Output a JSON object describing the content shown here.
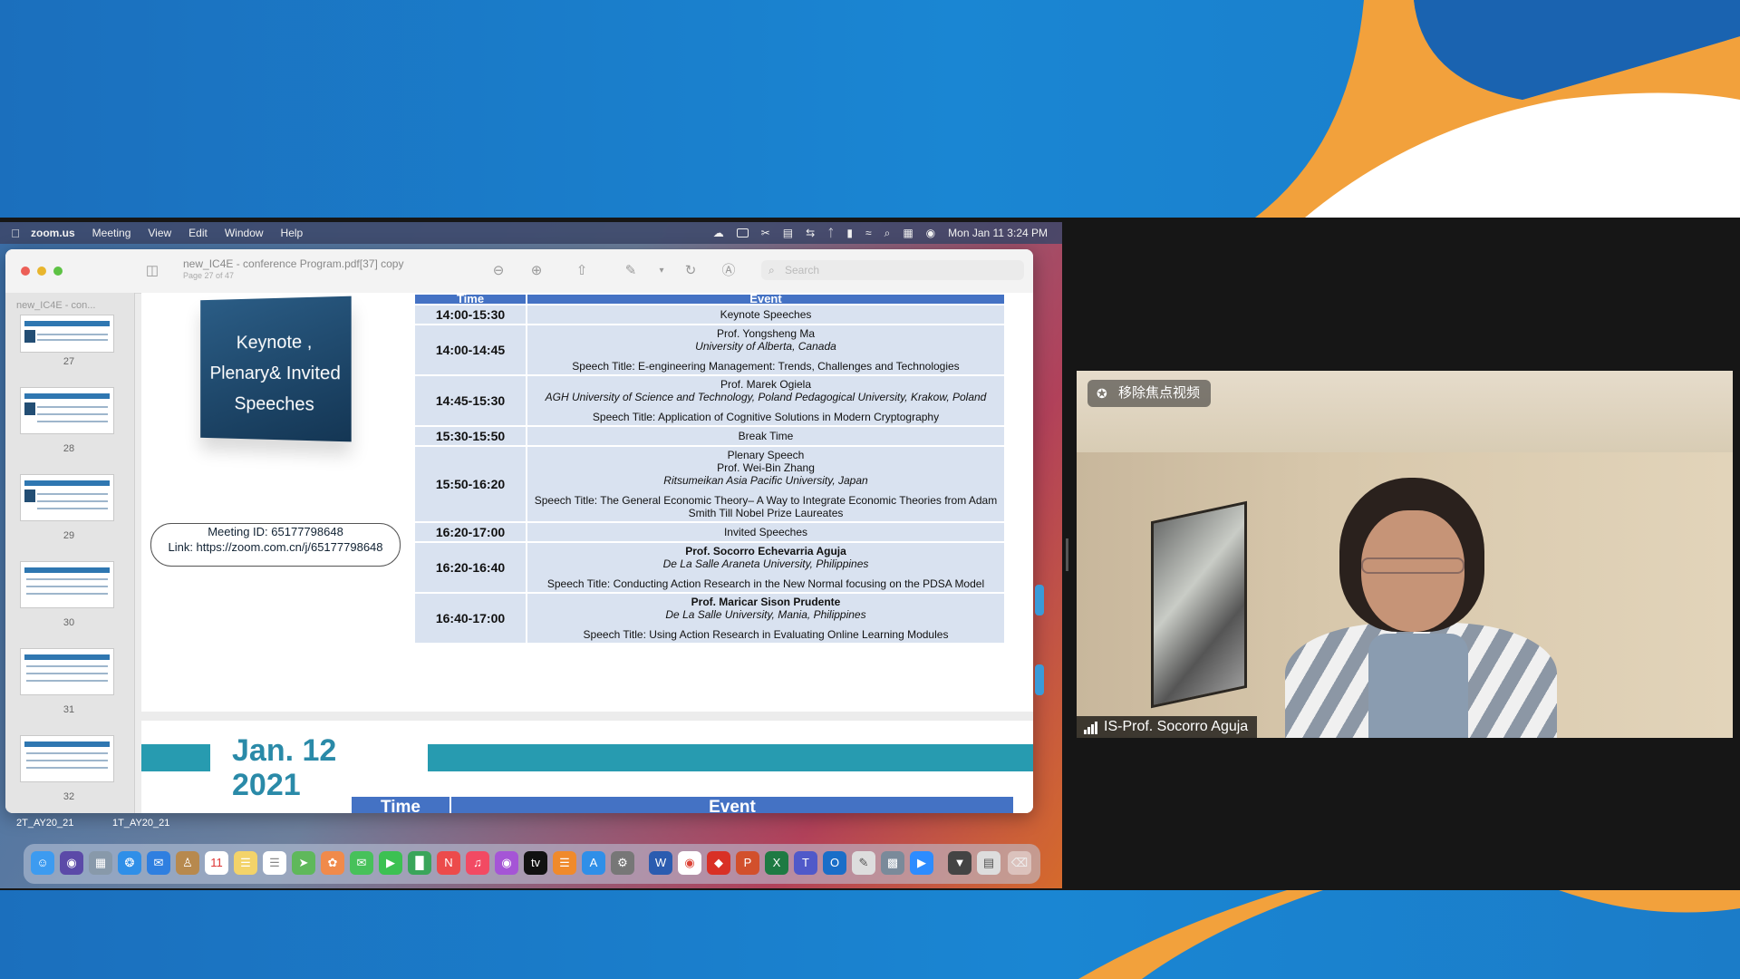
{
  "menubar": {
    "app": "zoom.us",
    "items": [
      "Meeting",
      "View",
      "Edit",
      "Window",
      "Help"
    ],
    "clock": "Mon Jan 11  3:24 PM"
  },
  "preview": {
    "title": "new_IC4E - conference Program.pdf[37] copy",
    "page_info": "Page 27 of 47",
    "search_placeholder": "Search",
    "sidebar_title": "new_IC4E - con...",
    "thumbnails": [
      "27",
      "28",
      "29",
      "30",
      "31",
      "32"
    ]
  },
  "slide": {
    "keynote_lines": [
      "Keynote ,",
      "Plenary& Invited",
      "Speeches"
    ],
    "meeting_id": "Meeting ID: 65177798648",
    "meeting_link": "Link: https://zoom.com.cn/j/65177798648",
    "header": [
      "Time",
      "Event"
    ],
    "rows": [
      {
        "time": "14:00-15:30",
        "lines": [
          {
            "text": "Keynote Speeches",
            "style": "plain"
          }
        ]
      },
      {
        "time": "14:00-14:45",
        "lines": [
          {
            "text": "Prof. Yongsheng Ma",
            "style": "plain"
          },
          {
            "text": "University of Alberta, Canada",
            "style": "italic"
          },
          {
            "text": "Speech Title: E-engineering Management: Trends, Challenges and Technologies",
            "style": "plain"
          }
        ]
      },
      {
        "time": "14:45-15:30",
        "lines": [
          {
            "text": "Prof. Marek Ogiela",
            "style": "plain"
          },
          {
            "text": "AGH University of Science and Technology, Poland      Pedagogical University, Krakow, Poland",
            "style": "italic"
          },
          {
            "text": "Speech Title: Application of Cognitive Solutions in Modern Cryptography",
            "style": "plain"
          }
        ]
      },
      {
        "time": "15:30-15:50",
        "lines": [
          {
            "text": "Break Time",
            "style": "plain"
          }
        ]
      },
      {
        "time": "15:50-16:20",
        "lines": [
          {
            "text": "Plenary Speech",
            "style": "plain"
          },
          {
            "text": "Prof. Wei-Bin Zhang",
            "style": "plain"
          },
          {
            "text": "Ritsumeikan Asia Pacific University, Japan",
            "style": "italic"
          },
          {
            "text": "Speech Title: The General Economic Theory– A Way to Integrate Economic Theories from Adam Smith Till Nobel Prize Laureates",
            "style": "plain"
          }
        ]
      },
      {
        "time": "16:20-17:00",
        "lines": [
          {
            "text": "Invited Speeches",
            "style": "plain"
          }
        ]
      },
      {
        "time": "16:20-16:40",
        "lines": [
          {
            "text": "Prof. Socorro Echevarria Aguja",
            "style": "bold"
          },
          {
            "text": "De La Salle Araneta University, Philippines",
            "style": "italic"
          },
          {
            "text": "Speech Title: Conducting Action Research in the New Normal focusing on the PDSA Model",
            "style": "plain"
          }
        ]
      },
      {
        "time": "16:40-17:00",
        "lines": [
          {
            "text": "Prof. Maricar Sison Prudente",
            "style": "bold"
          },
          {
            "text": "De La Salle University, Mania, Philippines",
            "style": "italic"
          },
          {
            "text": "Speech Title: Using Action Research in Evaluating Online Learning Modules",
            "style": "plain"
          }
        ]
      }
    ],
    "next_date_line1": "Jan. 12",
    "next_date_line2": "2021",
    "next_header": [
      "Time",
      "Event"
    ]
  },
  "desktop_files": [
    "2T_AY20_21",
    "1T_AY20_21"
  ],
  "dock_badge": "11",
  "video": {
    "pin_label": "移除焦点视频",
    "participant": "IS-Prof. Socorro Aguja"
  },
  "colors": {
    "table_header": "#4472c4",
    "table_cell": "#d9e2f0",
    "teal": "#279bb0",
    "brand_orange": "#f2a13c"
  }
}
